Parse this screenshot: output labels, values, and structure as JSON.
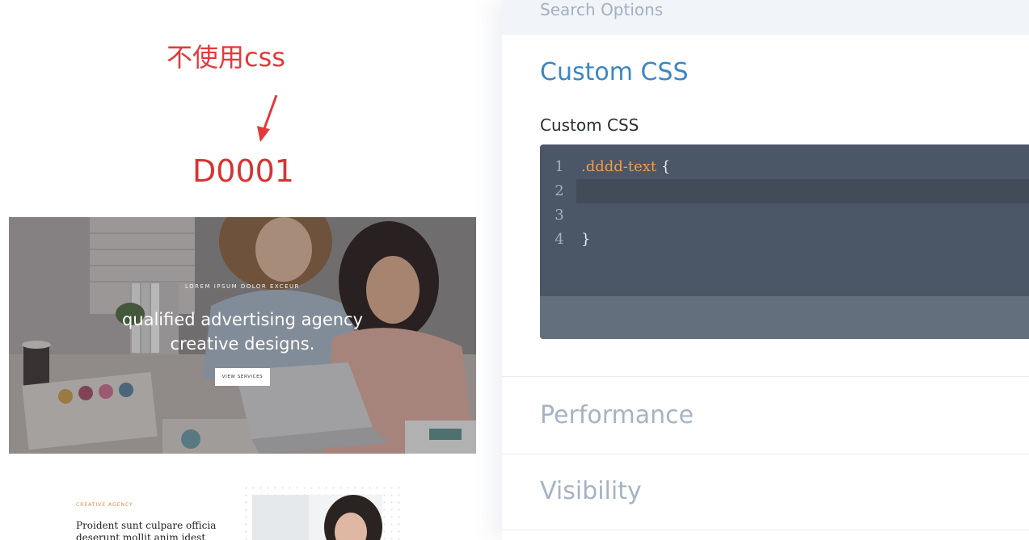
{
  "annotation": {
    "title": "不使用css",
    "code": "D0001"
  },
  "hero": {
    "kicker": "LOREM IPSUM DOLOR EXCEUR",
    "title_line1": "qualified advertising agency",
    "title_line2": "creative designs.",
    "button_label": "VIEW SERVICES"
  },
  "section_below": {
    "kicker": "CREATIVE AGENCY",
    "text": "Proident sunt culpare officia deserunt mollit anim idest"
  },
  "panel": {
    "search_label": "Search Options",
    "section_title": "Custom CSS",
    "field_label": "Custom CSS",
    "editor": {
      "lines": [
        {
          "number": "1",
          "selector": ".dddd-text",
          "rest": " {"
        },
        {
          "number": "2",
          "selector": "",
          "rest": ""
        },
        {
          "number": "3",
          "selector": "",
          "rest": ""
        },
        {
          "number": "4",
          "selector": "",
          "rest": "}"
        }
      ],
      "active_line": 2
    },
    "collapsed_sections": [
      "Performance",
      "Visibility"
    ]
  },
  "colors": {
    "annotation_red": "#e23a3a",
    "section_title_blue": "#3b86c6",
    "editor_bg": "#4b5666",
    "css_selector_orange": "#f29c4a"
  }
}
